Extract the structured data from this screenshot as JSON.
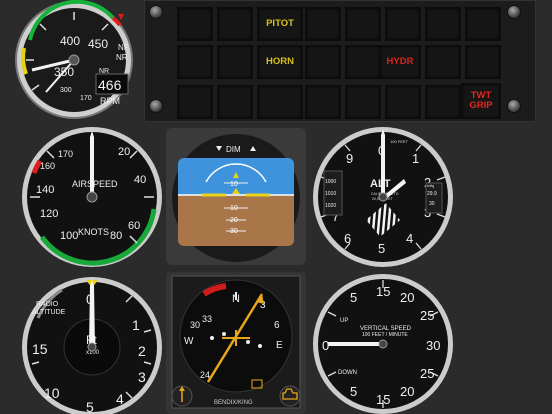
{
  "rotor_rpm": {
    "scale_labels": [
      "400",
      "450",
      "350",
      "300",
      "170"
    ],
    "nf_label": "NF",
    "nr_label": "NR",
    "digital_label": "NR",
    "digital_value": "466",
    "unit": "RPM"
  },
  "annunciator": {
    "lamps": [
      {
        "text": "PITOT",
        "color": "#d8c21a"
      },
      {
        "text": "HORN",
        "color": "#d8c21a"
      },
      {
        "text": "HYDR",
        "color": "#d8231a"
      },
      {
        "text": "TWT GRIP",
        "color": "#e0281e"
      }
    ]
  },
  "airspeed": {
    "labels": [
      "170",
      "160",
      "140",
      "120",
      "100",
      "80",
      "60",
      "40",
      "20"
    ],
    "title": "AIRSPEED",
    "unit": "KNOTS"
  },
  "attitude": {
    "dim_label": "DIM",
    "pitch_labels": [
      "10",
      "10",
      "20",
      "30"
    ]
  },
  "altimeter": {
    "labels": [
      "0",
      "1",
      "2",
      "3",
      "4",
      "5",
      "6",
      "7",
      "8",
      "9"
    ],
    "title": "ALT",
    "subtitle_1": "CALIBRATED TO",
    "subtitle_2": "20,000 FEET",
    "feet_label": "100 FEET",
    "baro_values": [
      "1000",
      "1010",
      "1020"
    ],
    "inhg_values": [
      "29.9",
      "30"
    ],
    "inhg_unit": "inHg"
  },
  "radio_altitude": {
    "title_1": "RADIO",
    "title_2": "ALTITUDE",
    "unit": "Ft",
    "multiplier": "x100",
    "labels": [
      "0",
      "1",
      "2",
      "3",
      "4",
      "5",
      "10",
      "15"
    ]
  },
  "hsi": {
    "labels": [
      "N",
      "3",
      "6",
      "E",
      "W",
      "33",
      "30",
      "24"
    ],
    "brand": "BENDIX/KING"
  },
  "vsi": {
    "labels": [
      "5",
      "10",
      "15",
      "20",
      "25",
      "30",
      "0",
      "5",
      "10",
      "15",
      "20",
      "25"
    ],
    "up_label": "UP",
    "down_label": "DOWN",
    "title": "VERTICAL SPEED",
    "subtitle": "100 FEET / MINUTE"
  }
}
